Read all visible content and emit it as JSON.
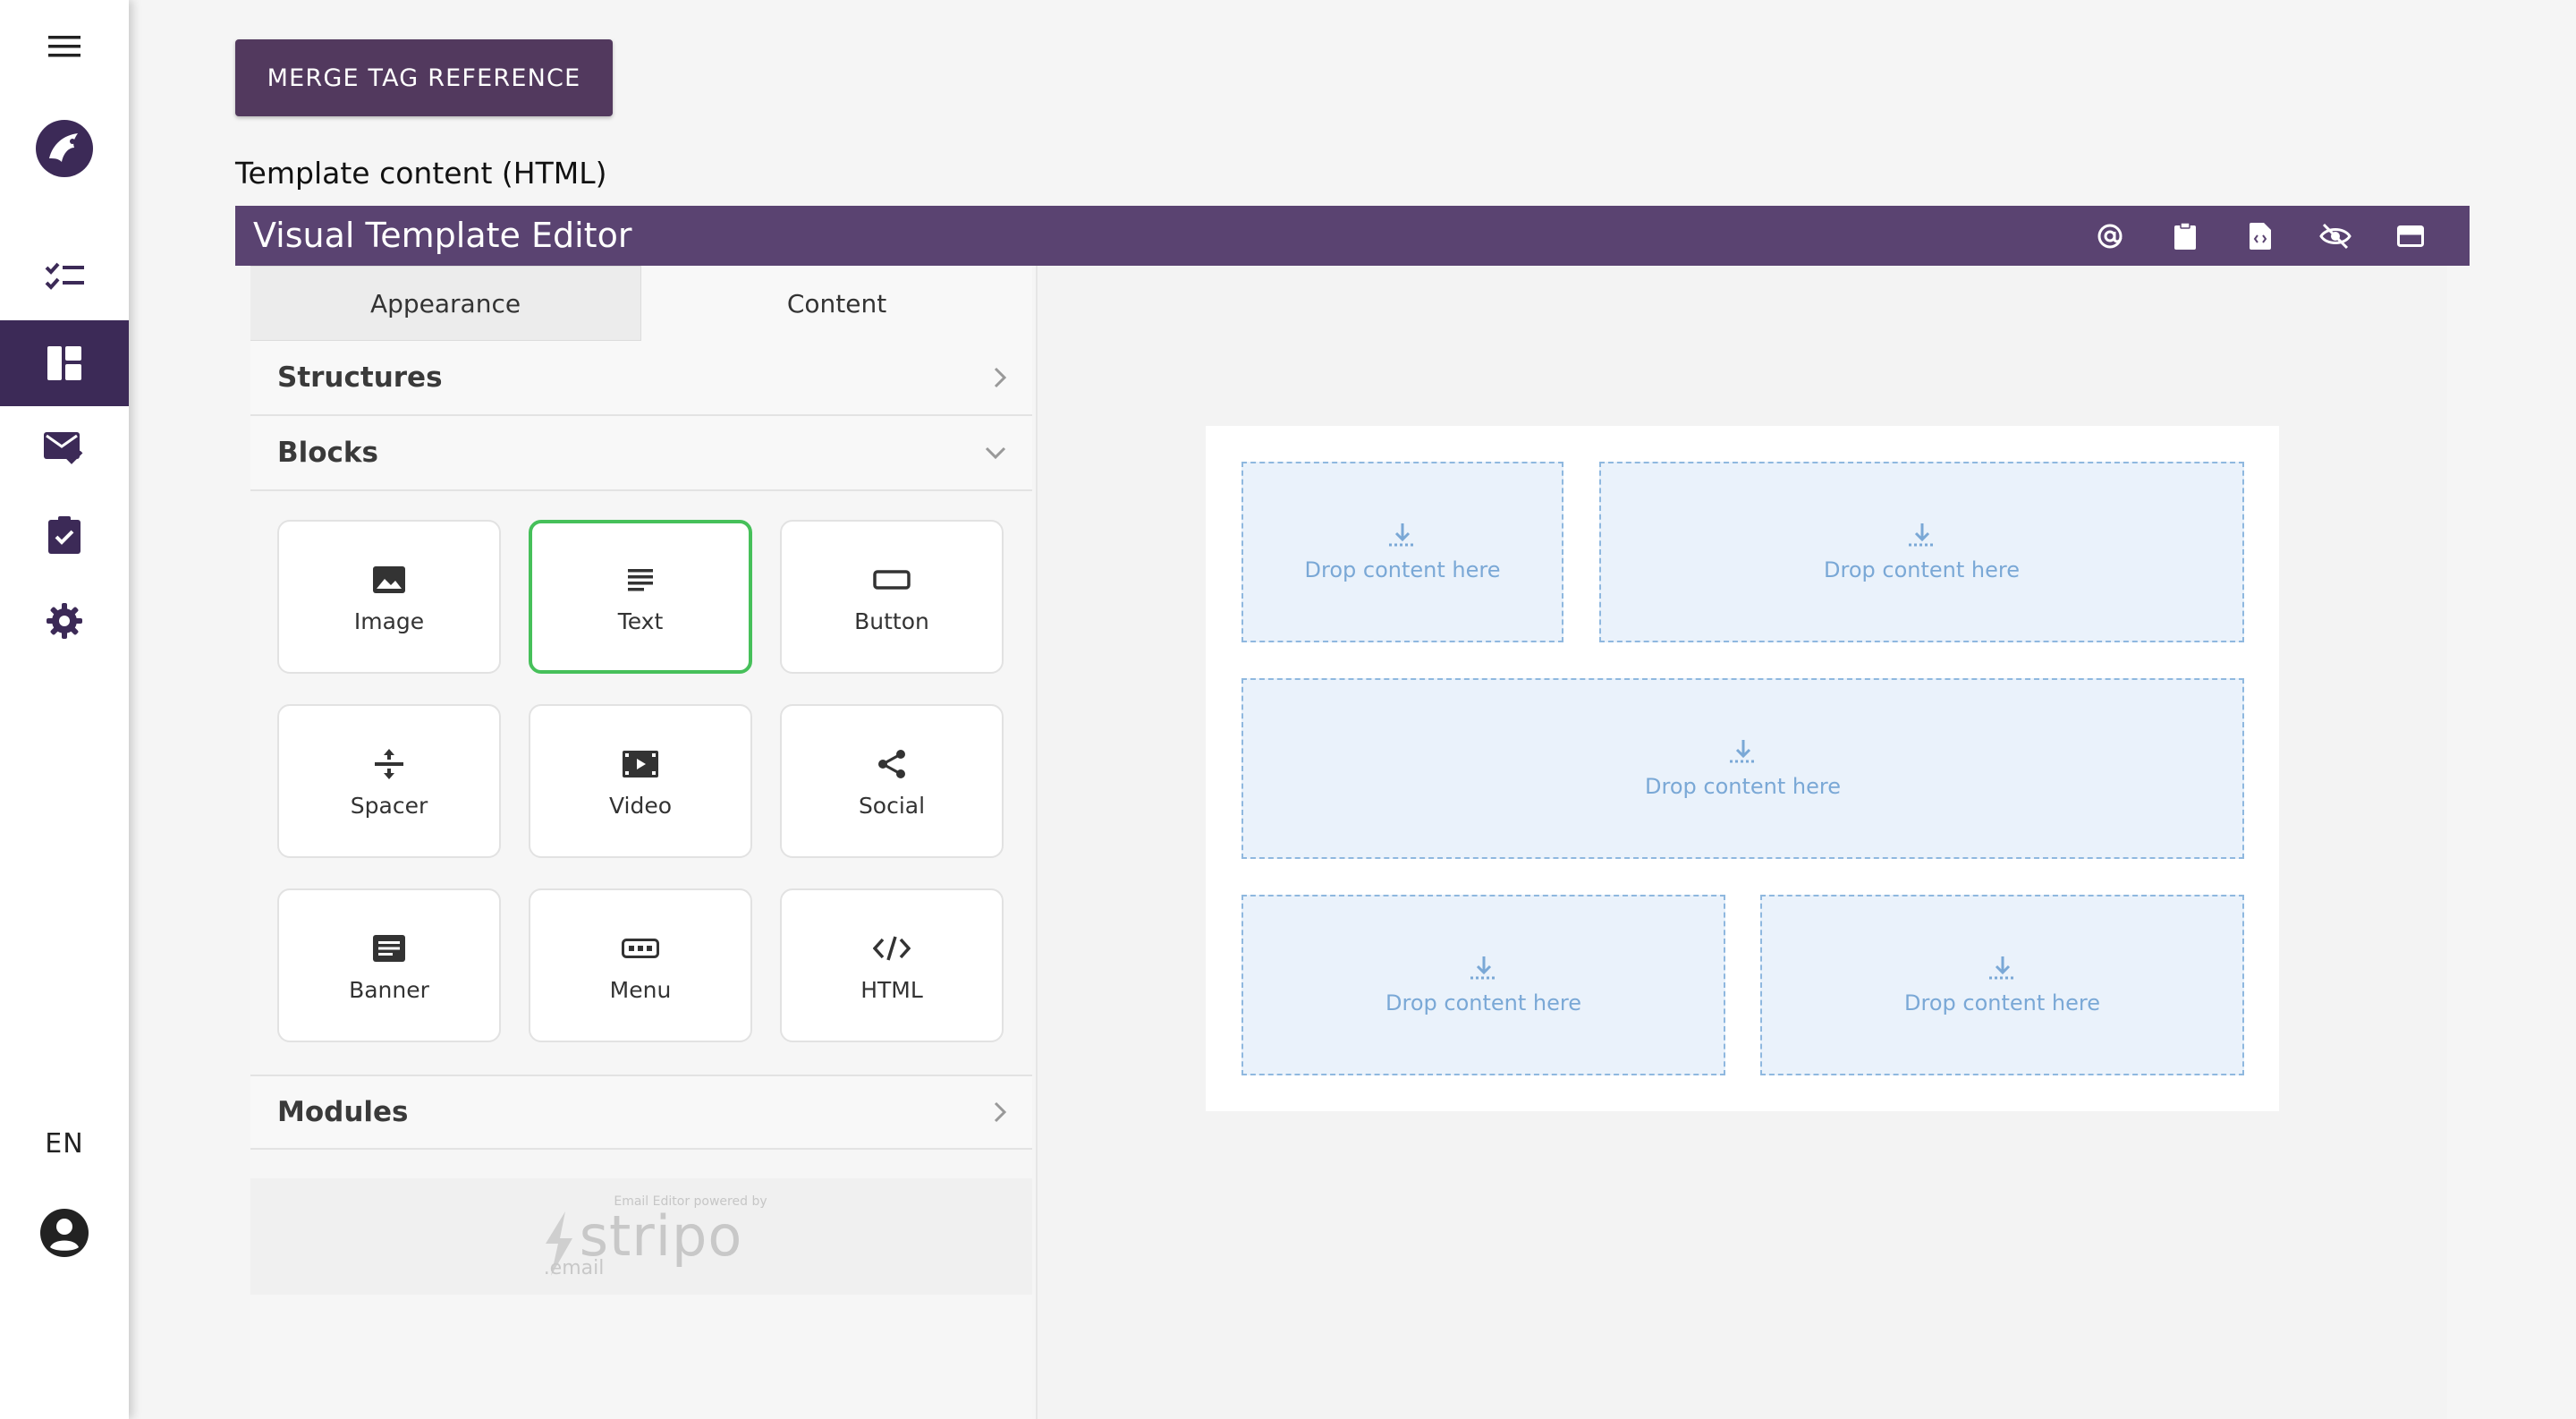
{
  "nav": {
    "language": "EN"
  },
  "toolbar": {
    "merge_tag_label": "MERGE TAG REFERENCE"
  },
  "template": {
    "section_label": "Template content (HTML)"
  },
  "editor": {
    "title": "Visual Template Editor",
    "tabs": [
      "Appearance",
      "Content"
    ],
    "active_tab": "Content",
    "sections": {
      "structures": "Structures",
      "blocks": "Blocks",
      "modules": "Modules"
    },
    "blocks": [
      {
        "label": "Image",
        "icon": "image-icon"
      },
      {
        "label": "Text",
        "icon": "text-icon",
        "selected": true
      },
      {
        "label": "Button",
        "icon": "button-icon"
      },
      {
        "label": "Spacer",
        "icon": "spacer-icon"
      },
      {
        "label": "Video",
        "icon": "video-icon"
      },
      {
        "label": "Social",
        "icon": "share-icon"
      },
      {
        "label": "Banner",
        "icon": "banner-icon"
      },
      {
        "label": "Menu",
        "icon": "menu-icon"
      },
      {
        "label": "HTML",
        "icon": "code-icon"
      }
    ],
    "branding": {
      "powered_by": "Email Editor powered by",
      "brand": "stripo",
      "sub": ".email"
    },
    "drop_zones": [
      {
        "label": "Drop content here"
      },
      {
        "label": "Drop content here"
      },
      {
        "label": "Drop content here"
      },
      {
        "label": "Drop content here"
      },
      {
        "label": "Drop content here"
      }
    ]
  },
  "colors": {
    "nav_active": "#3c2a57",
    "header_bar": "#5a4371",
    "merge_button": "#52395e",
    "selected_block_border": "#46c05a",
    "drop_zone_border": "#8fb8df"
  }
}
